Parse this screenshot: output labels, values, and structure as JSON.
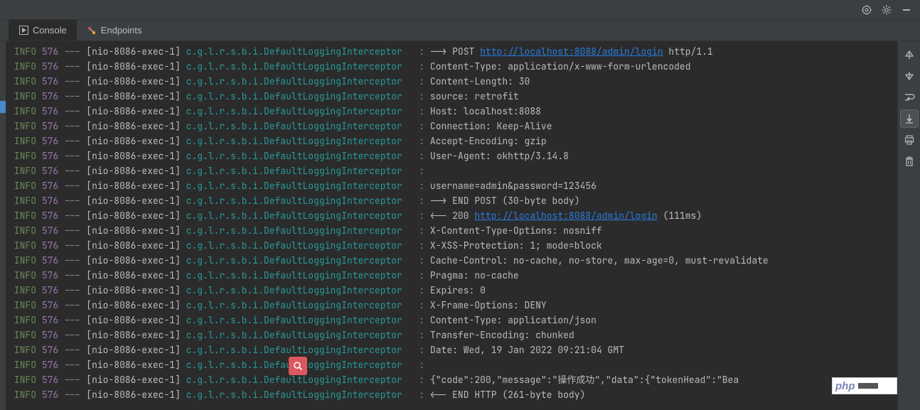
{
  "topbar": {
    "target_icon": "target-icon",
    "settings_icon": "gear-icon",
    "minimize_icon": "minimize-icon"
  },
  "tabs": [
    {
      "label": "Console",
      "active": true
    },
    {
      "label": "Endpoints",
      "active": false
    }
  ],
  "log_prefix": {
    "level": "INFO",
    "pid": "576",
    "dash": "---",
    "thread": "[nio-8086-exec-1]",
    "logger": "c.g.l.r.s.b.i.DefaultLoggingInterceptor",
    "sep": ":"
  },
  "lines": [
    {
      "pre": "--> POST ",
      "link": "http://localhost:8088/admin/login",
      "post": " http/1.1"
    },
    {
      "msg": "Content-Type: application/x-www-form-urlencoded"
    },
    {
      "msg": "Content-Length: 30"
    },
    {
      "msg": "source: retrofit"
    },
    {
      "msg": "Host: localhost:8088"
    },
    {
      "msg": "Connection: Keep-Alive"
    },
    {
      "msg": "Accept-Encoding: gzip"
    },
    {
      "msg": "User-Agent: okhttp/3.14.8"
    },
    {
      "msg": ""
    },
    {
      "msg": "username=admin&password=123456"
    },
    {
      "msg": "--> END POST (30-byte body)"
    },
    {
      "pre": "<-- 200 ",
      "link": "http://localhost:8088/admin/login",
      "post": " (111ms)"
    },
    {
      "msg": "X-Content-Type-Options: nosniff"
    },
    {
      "msg": "X-XSS-Protection: 1; mode=block"
    },
    {
      "msg": "Cache-Control: no-cache, no-store, max-age=0, must-revalidate"
    },
    {
      "msg": "Pragma: no-cache"
    },
    {
      "msg": "Expires: 0"
    },
    {
      "msg": "X-Frame-Options: DENY"
    },
    {
      "msg": "Content-Type: application/json"
    },
    {
      "msg": "Transfer-Encoding: chunked"
    },
    {
      "msg": "Date: Wed, 19 Jan 2022 09:21:04 GMT"
    },
    {
      "msg": ""
    },
    {
      "msg": "{\"code\":200,\"message\":\"操作成功\",\"data\":{\"tokenHead\":\"Bea"
    },
    {
      "msg": "<-- END HTTP (261-byte body)"
    }
  ],
  "right_tools": {
    "up": "arrow-up-icon",
    "down": "arrow-down-icon",
    "soft_wrap": "soft-wrap-icon",
    "scroll_end": "scroll-to-end-icon",
    "print": "print-icon",
    "clear": "trash-icon"
  },
  "search": {
    "icon": "search-icon"
  },
  "watermark": {
    "text1": "php",
    "text2": ""
  }
}
